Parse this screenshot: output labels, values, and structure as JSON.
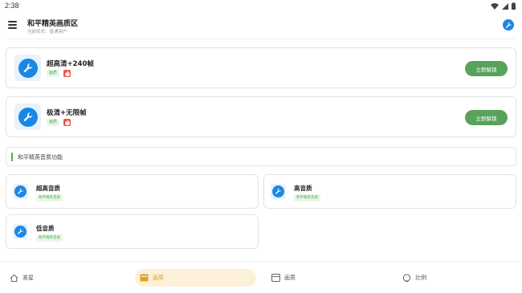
{
  "status_bar": {
    "time": "2:38"
  },
  "header": {
    "title": "和平精英画质区",
    "subtitle": "当前状态：普通用户"
  },
  "feature_cards": [
    {
      "title": "超高清+240帧",
      "tag": "画质",
      "button": "立即解锁"
    },
    {
      "title": "极清+无限帧",
      "tag": "画质",
      "button": "立即解锁"
    }
  ],
  "section": {
    "title": "和平精英音质功能"
  },
  "audio_cards": [
    {
      "title": "超高音质",
      "tag": "和平精英音质"
    },
    {
      "title": "高音质",
      "tag": "和平精英音质"
    },
    {
      "title": "低音质",
      "tag": "和平精英音质"
    }
  ],
  "bottom_nav": [
    {
      "label": "准星",
      "icon": "home-icon",
      "active": false
    },
    {
      "label": "画质",
      "icon": "image-icon",
      "active": true
    },
    {
      "label": "画质",
      "icon": "image-icon",
      "active": false
    },
    {
      "label": "比例",
      "icon": "aspect-icon",
      "active": false
    }
  ],
  "colors": {
    "accent_blue": "#1b87e5",
    "unlock_green": "#58a25c",
    "tag_green": "#4caf50",
    "nav_active": "#e6a01c"
  }
}
